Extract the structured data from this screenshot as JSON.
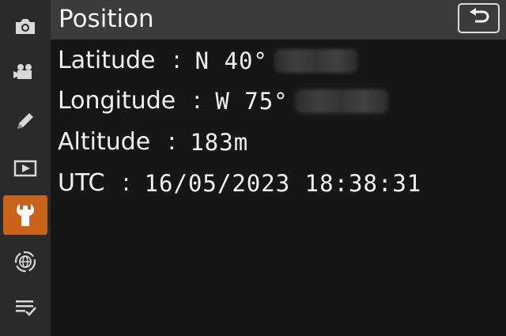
{
  "sidebar": {
    "items": [
      {
        "name": "photo-shooting-menu",
        "icon": "camera-icon",
        "active": false
      },
      {
        "name": "movie-recording-menu",
        "icon": "movie-camera-icon",
        "active": false
      },
      {
        "name": "custom-settings-menu",
        "icon": "pencil-icon",
        "active": false
      },
      {
        "name": "playback-menu",
        "icon": "playback-icon",
        "active": false
      },
      {
        "name": "setup-menu",
        "icon": "wrench-icon",
        "active": true
      },
      {
        "name": "network-menu",
        "icon": "network-globe-icon",
        "active": false
      },
      {
        "name": "my-menu",
        "icon": "my-menu-checklist-icon",
        "active": false
      }
    ],
    "active_color": "#c9621c"
  },
  "header": {
    "title": "Position",
    "back_icon": "return-arrow-icon"
  },
  "position": {
    "latitude_label": "Latitude",
    "latitude_sep": ":",
    "latitude_value": "N 40°",
    "longitude_label": "Longitude",
    "longitude_sep": ":",
    "longitude_value": "W 75°",
    "altitude_label": "Altitude",
    "altitude_sep": ":",
    "altitude_value": "183m",
    "utc_label": "UTC",
    "utc_sep": ":",
    "utc_value": "16/05/2023 18:38:31"
  }
}
